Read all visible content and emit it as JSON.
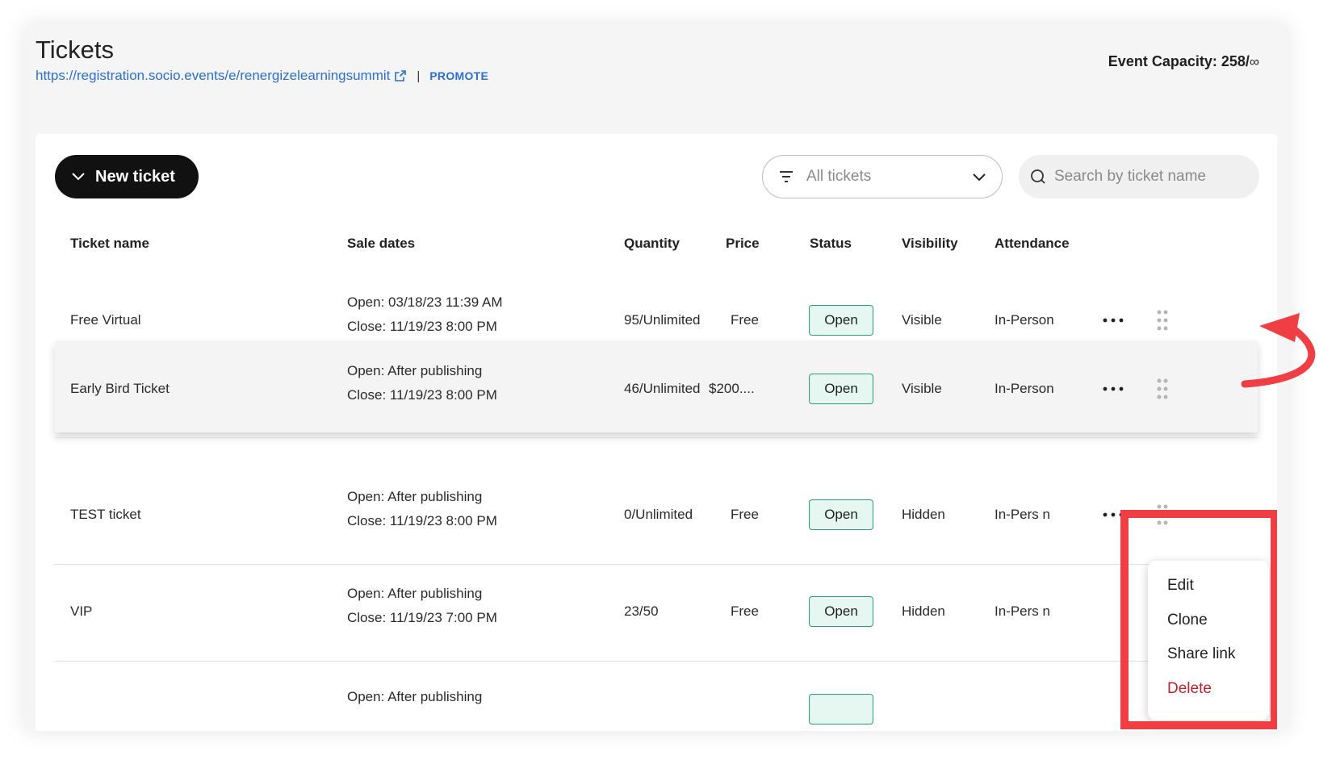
{
  "page": {
    "title": "Tickets",
    "url": "https://registration.socio.events/e/renergizelearningsummit",
    "separator": "|",
    "promote_label": "PROMOTE",
    "capacity_label": "Event Capacity: 258/",
    "capacity_suffix": "∞"
  },
  "toolbar": {
    "new_ticket_label": "New ticket",
    "filter_label": "All tickets",
    "search_placeholder": "Search by ticket name"
  },
  "table": {
    "headers": [
      "Ticket name",
      "Sale dates",
      "Quantity",
      "Price",
      "Status",
      "Visibility",
      "Attendance"
    ],
    "rows": [
      {
        "name": "Free Virtual",
        "open": "Open: 03/18/23 11:39 AM",
        "close": "Close: 11/19/23 8:00 PM",
        "quantity": "95/Unlimited",
        "price": "Free",
        "status": "Open",
        "visibility": "Visible",
        "attendance": "In-Person"
      },
      {
        "name": "Early Bird Ticket",
        "open": "Open: After publishing",
        "close": "Close: 11/19/23 8:00 PM",
        "quantity": "46/Unlimited",
        "price": "$200....",
        "status": "Open",
        "visibility": "Visible",
        "attendance": "In-Person"
      },
      {
        "name": "TEST ticket",
        "open": "Open: After publishing",
        "close": "Close: 11/19/23 8:00 PM",
        "quantity": "0/Unlimited",
        "price": "Free",
        "status": "Open",
        "visibility": "Hidden",
        "attendance": "In-Pers   n"
      },
      {
        "name": "VIP",
        "open": "Open: After publishing",
        "close": "Close: 11/19/23 7:00 PM",
        "quantity": "23/50",
        "price": "Free",
        "status": "Open",
        "visibility": "Hidden",
        "attendance": "In-Pers   n"
      },
      {
        "open": "Open: After publishing"
      }
    ]
  },
  "menu": {
    "items": [
      "Edit",
      "Clone",
      "Share link",
      "Delete"
    ]
  },
  "colors": {
    "accent": "#2a6fd6",
    "status_border": "#2c9c7a",
    "status_bg": "#e6f6f0",
    "highlight": "#ef3e44",
    "danger": "#c21f2e"
  },
  "icons": [
    "external-link-icon",
    "chevron-down-icon",
    "filter-icon",
    "search-icon",
    "more-icon",
    "drag-handle-icon",
    "curved-arrow-icon"
  ]
}
